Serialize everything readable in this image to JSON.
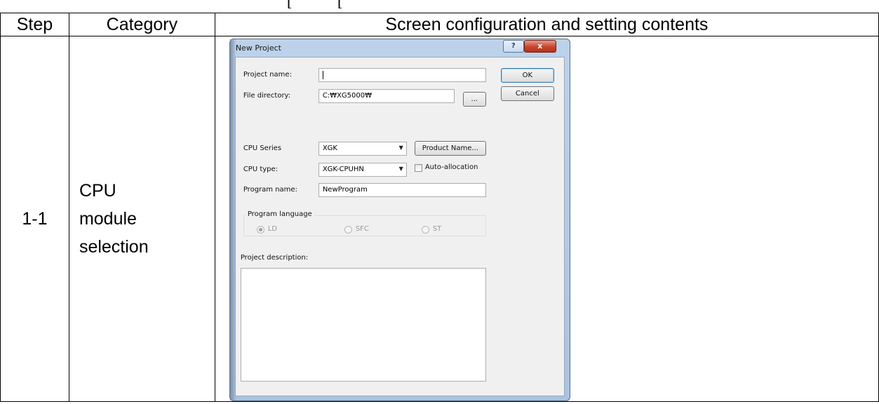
{
  "table": {
    "headers": {
      "step": "Step",
      "category": "Category",
      "screen": "Screen configuration and setting contents"
    },
    "row": {
      "step": "1-1",
      "category_lines": [
        "CPU",
        "module",
        "selection"
      ]
    }
  },
  "top_fragment": {
    "left": "[",
    "right": "["
  },
  "dialog": {
    "title": "New Project",
    "help_button": "?",
    "close_button": "x",
    "project_name_label": "Project name:",
    "project_name_value": "",
    "file_directory_label": "File directory:",
    "file_directory_value": "C:₩XG5000₩",
    "browse_button": "...",
    "ok_button": "OK",
    "cancel_button": "Cancel",
    "cpu_series_label": "CPU Series",
    "cpu_series_value": "XGK",
    "product_name_button": "Product Name...",
    "cpu_type_label": "CPU type:",
    "cpu_type_value": "XGK-CPUHN",
    "auto_allocation_label": "Auto-allocation",
    "program_name_label": "Program name:",
    "program_name_value": "NewProgram",
    "program_language_label": "Program language",
    "languages": {
      "ld": "LD",
      "sfc": "SFC",
      "st": "ST"
    },
    "project_description_label": "Project description:"
  }
}
